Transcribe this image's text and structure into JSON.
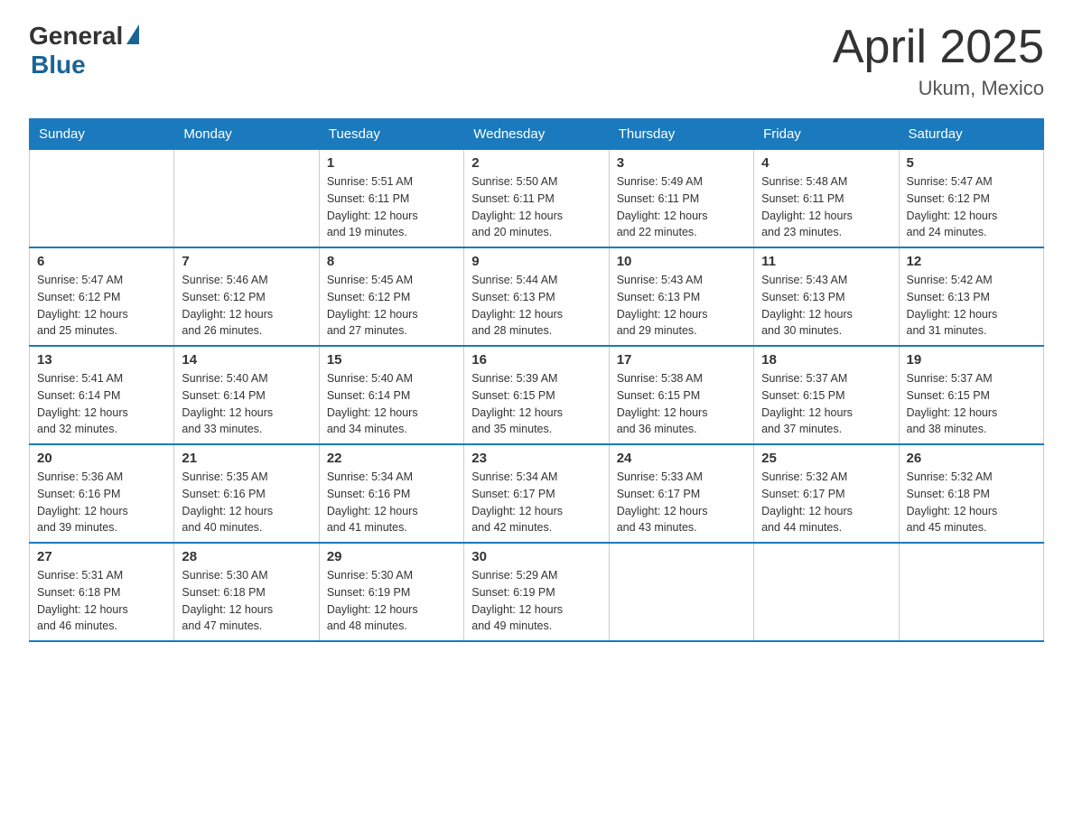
{
  "header": {
    "logo_general": "General",
    "logo_blue": "Blue",
    "title": "April 2025",
    "location": "Ukum, Mexico"
  },
  "weekdays": [
    "Sunday",
    "Monday",
    "Tuesday",
    "Wednesday",
    "Thursday",
    "Friday",
    "Saturday"
  ],
  "weeks": [
    [
      {
        "day": "",
        "info": ""
      },
      {
        "day": "",
        "info": ""
      },
      {
        "day": "1",
        "info": "Sunrise: 5:51 AM\nSunset: 6:11 PM\nDaylight: 12 hours\nand 19 minutes."
      },
      {
        "day": "2",
        "info": "Sunrise: 5:50 AM\nSunset: 6:11 PM\nDaylight: 12 hours\nand 20 minutes."
      },
      {
        "day": "3",
        "info": "Sunrise: 5:49 AM\nSunset: 6:11 PM\nDaylight: 12 hours\nand 22 minutes."
      },
      {
        "day": "4",
        "info": "Sunrise: 5:48 AM\nSunset: 6:11 PM\nDaylight: 12 hours\nand 23 minutes."
      },
      {
        "day": "5",
        "info": "Sunrise: 5:47 AM\nSunset: 6:12 PM\nDaylight: 12 hours\nand 24 minutes."
      }
    ],
    [
      {
        "day": "6",
        "info": "Sunrise: 5:47 AM\nSunset: 6:12 PM\nDaylight: 12 hours\nand 25 minutes."
      },
      {
        "day": "7",
        "info": "Sunrise: 5:46 AM\nSunset: 6:12 PM\nDaylight: 12 hours\nand 26 minutes."
      },
      {
        "day": "8",
        "info": "Sunrise: 5:45 AM\nSunset: 6:12 PM\nDaylight: 12 hours\nand 27 minutes."
      },
      {
        "day": "9",
        "info": "Sunrise: 5:44 AM\nSunset: 6:13 PM\nDaylight: 12 hours\nand 28 minutes."
      },
      {
        "day": "10",
        "info": "Sunrise: 5:43 AM\nSunset: 6:13 PM\nDaylight: 12 hours\nand 29 minutes."
      },
      {
        "day": "11",
        "info": "Sunrise: 5:43 AM\nSunset: 6:13 PM\nDaylight: 12 hours\nand 30 minutes."
      },
      {
        "day": "12",
        "info": "Sunrise: 5:42 AM\nSunset: 6:13 PM\nDaylight: 12 hours\nand 31 minutes."
      }
    ],
    [
      {
        "day": "13",
        "info": "Sunrise: 5:41 AM\nSunset: 6:14 PM\nDaylight: 12 hours\nand 32 minutes."
      },
      {
        "day": "14",
        "info": "Sunrise: 5:40 AM\nSunset: 6:14 PM\nDaylight: 12 hours\nand 33 minutes."
      },
      {
        "day": "15",
        "info": "Sunrise: 5:40 AM\nSunset: 6:14 PM\nDaylight: 12 hours\nand 34 minutes."
      },
      {
        "day": "16",
        "info": "Sunrise: 5:39 AM\nSunset: 6:15 PM\nDaylight: 12 hours\nand 35 minutes."
      },
      {
        "day": "17",
        "info": "Sunrise: 5:38 AM\nSunset: 6:15 PM\nDaylight: 12 hours\nand 36 minutes."
      },
      {
        "day": "18",
        "info": "Sunrise: 5:37 AM\nSunset: 6:15 PM\nDaylight: 12 hours\nand 37 minutes."
      },
      {
        "day": "19",
        "info": "Sunrise: 5:37 AM\nSunset: 6:15 PM\nDaylight: 12 hours\nand 38 minutes."
      }
    ],
    [
      {
        "day": "20",
        "info": "Sunrise: 5:36 AM\nSunset: 6:16 PM\nDaylight: 12 hours\nand 39 minutes."
      },
      {
        "day": "21",
        "info": "Sunrise: 5:35 AM\nSunset: 6:16 PM\nDaylight: 12 hours\nand 40 minutes."
      },
      {
        "day": "22",
        "info": "Sunrise: 5:34 AM\nSunset: 6:16 PM\nDaylight: 12 hours\nand 41 minutes."
      },
      {
        "day": "23",
        "info": "Sunrise: 5:34 AM\nSunset: 6:17 PM\nDaylight: 12 hours\nand 42 minutes."
      },
      {
        "day": "24",
        "info": "Sunrise: 5:33 AM\nSunset: 6:17 PM\nDaylight: 12 hours\nand 43 minutes."
      },
      {
        "day": "25",
        "info": "Sunrise: 5:32 AM\nSunset: 6:17 PM\nDaylight: 12 hours\nand 44 minutes."
      },
      {
        "day": "26",
        "info": "Sunrise: 5:32 AM\nSunset: 6:18 PM\nDaylight: 12 hours\nand 45 minutes."
      }
    ],
    [
      {
        "day": "27",
        "info": "Sunrise: 5:31 AM\nSunset: 6:18 PM\nDaylight: 12 hours\nand 46 minutes."
      },
      {
        "day": "28",
        "info": "Sunrise: 5:30 AM\nSunset: 6:18 PM\nDaylight: 12 hours\nand 47 minutes."
      },
      {
        "day": "29",
        "info": "Sunrise: 5:30 AM\nSunset: 6:19 PM\nDaylight: 12 hours\nand 48 minutes."
      },
      {
        "day": "30",
        "info": "Sunrise: 5:29 AM\nSunset: 6:19 PM\nDaylight: 12 hours\nand 49 minutes."
      },
      {
        "day": "",
        "info": ""
      },
      {
        "day": "",
        "info": ""
      },
      {
        "day": "",
        "info": ""
      }
    ]
  ]
}
